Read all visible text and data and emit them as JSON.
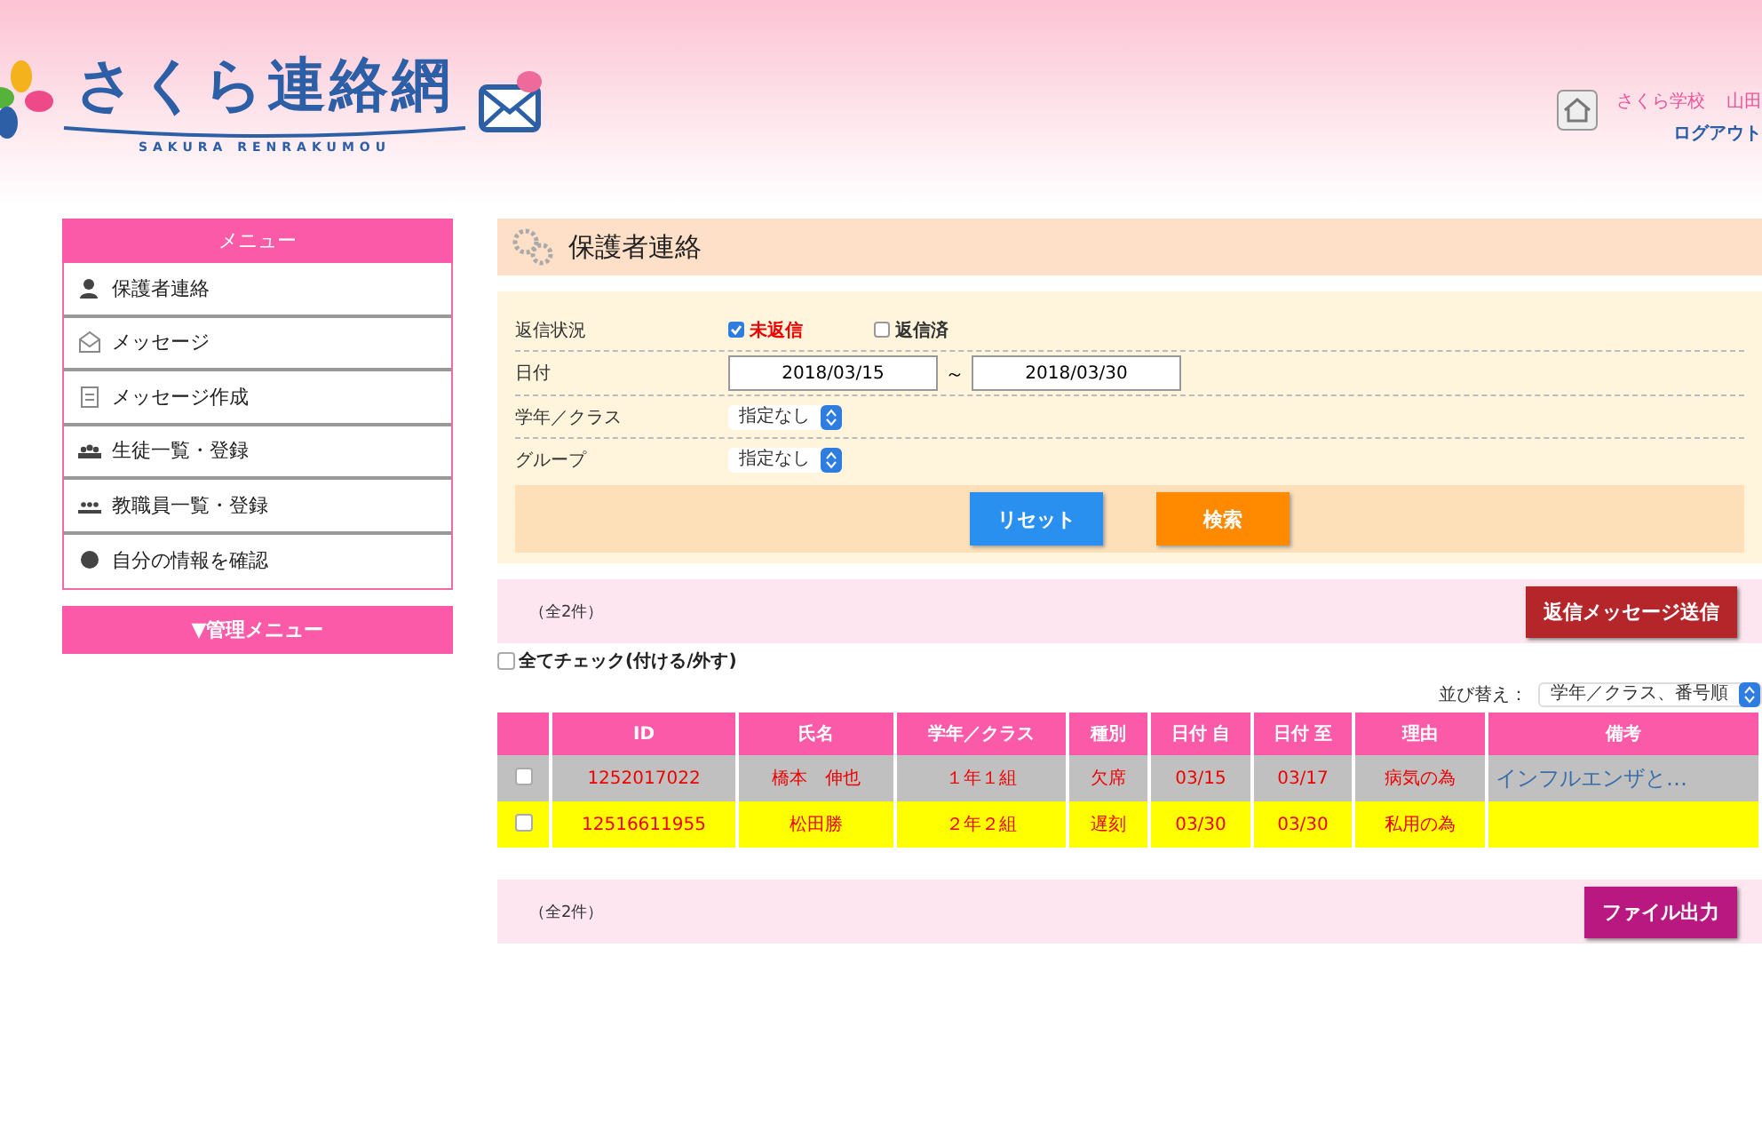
{
  "header": {
    "logo_title": "さくら連絡網",
    "logo_subtitle": "SAKURA RENRAKUMOU",
    "school": "さくら学校",
    "user": "山田",
    "logout": "ログアウト"
  },
  "sidebar": {
    "title": "メニュー",
    "items": [
      {
        "label": "保護者連絡"
      },
      {
        "label": "メッセージ"
      },
      {
        "label": "メッセージ作成"
      },
      {
        "label": "生徒一覧・登録"
      },
      {
        "label": "教職員一覧・登録"
      },
      {
        "label": "自分の情報を確認"
      }
    ],
    "admin_menu": "▼管理メニュー"
  },
  "page_title": "保護者連絡",
  "filters": {
    "reply_status": {
      "label": "返信状況",
      "options": [
        {
          "label": "未返信",
          "checked": true
        },
        {
          "label": "返信済",
          "checked": false
        }
      ]
    },
    "date": {
      "label": "日付",
      "from": "2018/03/15",
      "separator": "～",
      "to": "2018/03/30"
    },
    "class": {
      "label": "学年／クラス",
      "value": "指定なし"
    },
    "group": {
      "label": "グループ",
      "value": "指定なし"
    },
    "reset": "リセット",
    "search": "検索"
  },
  "count_top": "（全2件）",
  "reply_button": "返信メッセージ送信",
  "check_all": {
    "label": "全てチェック(付ける/外す)",
    "checked": false
  },
  "sort": {
    "label": "並び替え：",
    "value": "学年／クラス、番号順"
  },
  "table": {
    "columns": [
      "ID",
      "氏名",
      "学年／クラス",
      "種別",
      "日付 自",
      "日付 至",
      "理由",
      "備考"
    ],
    "rows": [
      {
        "checked": false,
        "color": "#c0c0c0",
        "cells": [
          "1252017022",
          "橋本　伸也",
          "１年１組",
          "欠席",
          "03/15",
          "03/17",
          "病気の為",
          "インフルエンザと…"
        ]
      },
      {
        "checked": false,
        "color": "#ffff00",
        "cells": [
          "12516611955",
          "松田勝",
          "２年２組",
          "遅刻",
          "03/30",
          "03/30",
          "私用の為",
          ""
        ]
      }
    ]
  },
  "count_bottom": "（全2件）",
  "export_button": "ファイル出力"
}
